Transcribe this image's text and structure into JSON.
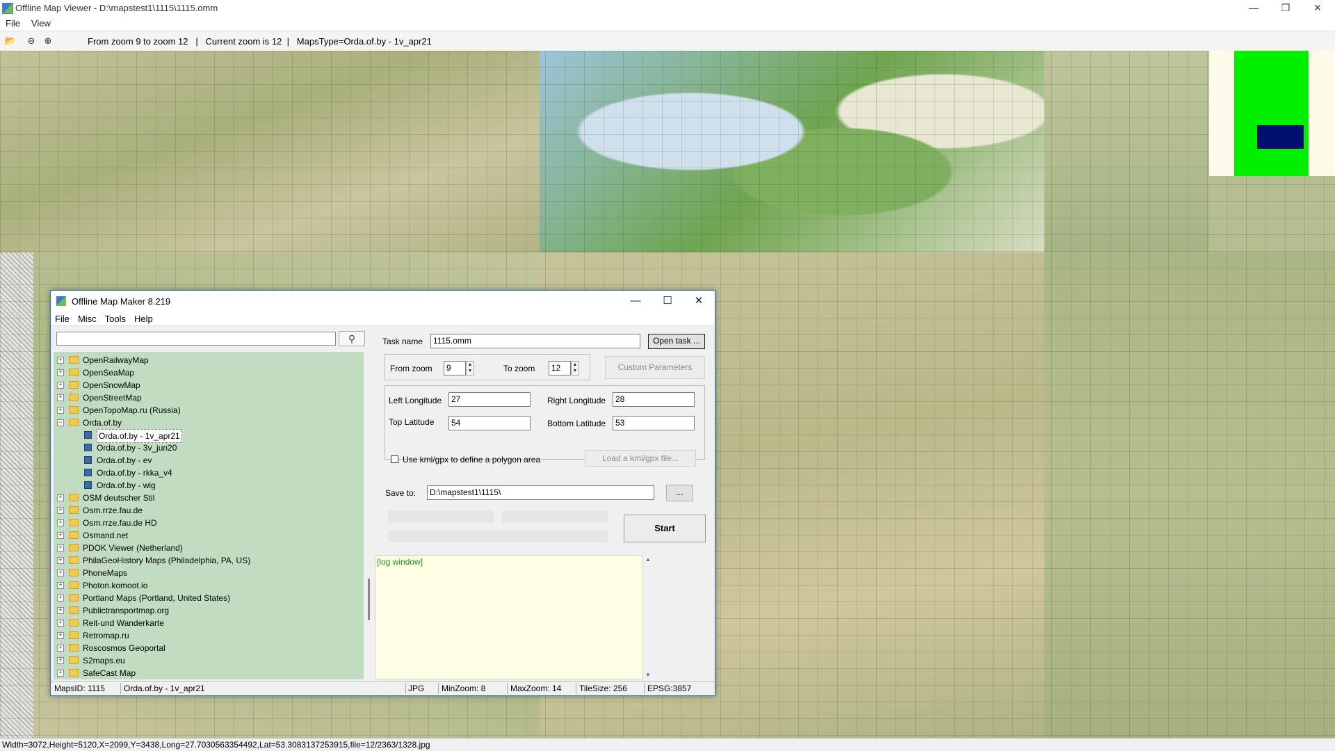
{
  "viewer": {
    "title": "Offline Map Viewer - D:\\mapstest1\\1115\\1115.omm",
    "menu": [
      "File",
      "View"
    ],
    "toolbar_info": "From zoom 9 to zoom 12   |   Current zoom is 12  |   MapsType=Orda.of.by - 1v_apr21",
    "status": "Width=3072,Height=5120,X=2099,Y=3438,Long=27.7030563354492,Lat=53.3083137253915,file=12/2363/1328.jpg"
  },
  "dialog": {
    "title": "Offline Map Maker 8.219",
    "menu": [
      "File",
      "Misc",
      "Tools",
      "Help"
    ],
    "search": {
      "value": "",
      "placeholder": ""
    },
    "tree": [
      {
        "label": "OpenRailwayMap",
        "level": 0,
        "type": "folder",
        "expanded": false
      },
      {
        "label": "OpenSeaMap",
        "level": 0,
        "type": "folder",
        "expanded": false
      },
      {
        "label": "OpenSnowMap",
        "level": 0,
        "type": "folder",
        "expanded": false
      },
      {
        "label": "OpenStreetMap",
        "level": 0,
        "type": "folder",
        "expanded": false
      },
      {
        "label": "OpenTopoMap.ru (Russia)",
        "level": 0,
        "type": "folder",
        "expanded": false
      },
      {
        "label": "Orda.of.by",
        "level": 0,
        "type": "folder",
        "expanded": true
      },
      {
        "label": "Orda.of.by - 1v_apr21",
        "level": 1,
        "type": "map",
        "selected": true
      },
      {
        "label": "Orda.of.by - 3v_jun20",
        "level": 1,
        "type": "map"
      },
      {
        "label": "Orda.of.by - ev",
        "level": 1,
        "type": "map"
      },
      {
        "label": "Orda.of.by - rkka_v4",
        "level": 1,
        "type": "map"
      },
      {
        "label": "Orda.of.by - wig",
        "level": 1,
        "type": "map"
      },
      {
        "label": "OSM deutscher Stil",
        "level": 0,
        "type": "folder",
        "expanded": false
      },
      {
        "label": "Osm.rrze.fau.de",
        "level": 0,
        "type": "folder",
        "expanded": false
      },
      {
        "label": "Osm.rrze.fau.de HD",
        "level": 0,
        "type": "folder",
        "expanded": false
      },
      {
        "label": "Osmand.net",
        "level": 0,
        "type": "folder",
        "expanded": false
      },
      {
        "label": "PDOK Viewer (Netherland)",
        "level": 0,
        "type": "folder",
        "expanded": false
      },
      {
        "label": "PhilaGeoHistory Maps (Philadelphia, PA, US)",
        "level": 0,
        "type": "folder",
        "expanded": false
      },
      {
        "label": "PhoneMaps",
        "level": 0,
        "type": "folder",
        "expanded": false
      },
      {
        "label": "Photon.komoot.io",
        "level": 0,
        "type": "folder",
        "expanded": false
      },
      {
        "label": "Portland Maps (Portland, United States)",
        "level": 0,
        "type": "folder",
        "expanded": false
      },
      {
        "label": "Publictransportmap.org",
        "level": 0,
        "type": "folder",
        "expanded": false
      },
      {
        "label": "Reit-und Wanderkarte",
        "level": 0,
        "type": "folder",
        "expanded": false
      },
      {
        "label": "Retromap.ru",
        "level": 0,
        "type": "folder",
        "expanded": false
      },
      {
        "label": "Roscosmos Geoportal",
        "level": 0,
        "type": "folder",
        "expanded": false
      },
      {
        "label": "S2maps.eu",
        "level": 0,
        "type": "folder",
        "expanded": false
      },
      {
        "label": "SafeCast Map",
        "level": 0,
        "type": "folder",
        "expanded": false
      }
    ],
    "task": {
      "task_name_label": "Task name",
      "task_name_value": "1115.omm",
      "open_task_label": "Open task ...",
      "from_zoom_label": "From zoom",
      "from_zoom_value": "9",
      "to_zoom_label": "To zoom",
      "to_zoom_value": "12",
      "custom_params_label": "Custom Parameters",
      "left_lon_label": "Left Longitude",
      "left_lon_value": "27",
      "right_lon_label": "Right Longitude",
      "right_lon_value": "28",
      "top_lat_label": "Top Latitude",
      "top_lat_value": "54",
      "bottom_lat_label": "Bottom Latitude",
      "bottom_lat_value": "53",
      "kml_label": "Use kml/gpx to define a polygon area",
      "kml_checked": false,
      "load_kml_label": "Load a kml/gpx file...",
      "save_to_label": "Save to:",
      "save_to_value": "D:\\mapstest1\\1115\\",
      "browse_label": "...",
      "start_label": "Start"
    },
    "log_text": "[log window]",
    "status": {
      "maps_id": "MapsID: 1115",
      "map_name": "Orda.of.by - 1v_apr21",
      "format": "JPG",
      "min_zoom": "MinZoom: 8",
      "max_zoom": "MaxZoom: 14",
      "tile_size": "TileSize: 256",
      "epsg": "EPSG:3857"
    }
  },
  "colors": {
    "tree_bg": "#c1dcc1",
    "log_bg": "#ffffe6",
    "log_text": "#228b22",
    "overview_bg": "#fffbea",
    "overview_green": "#00f000",
    "overview_blue": "#001070",
    "dialog_border": "#1a73c8"
  }
}
